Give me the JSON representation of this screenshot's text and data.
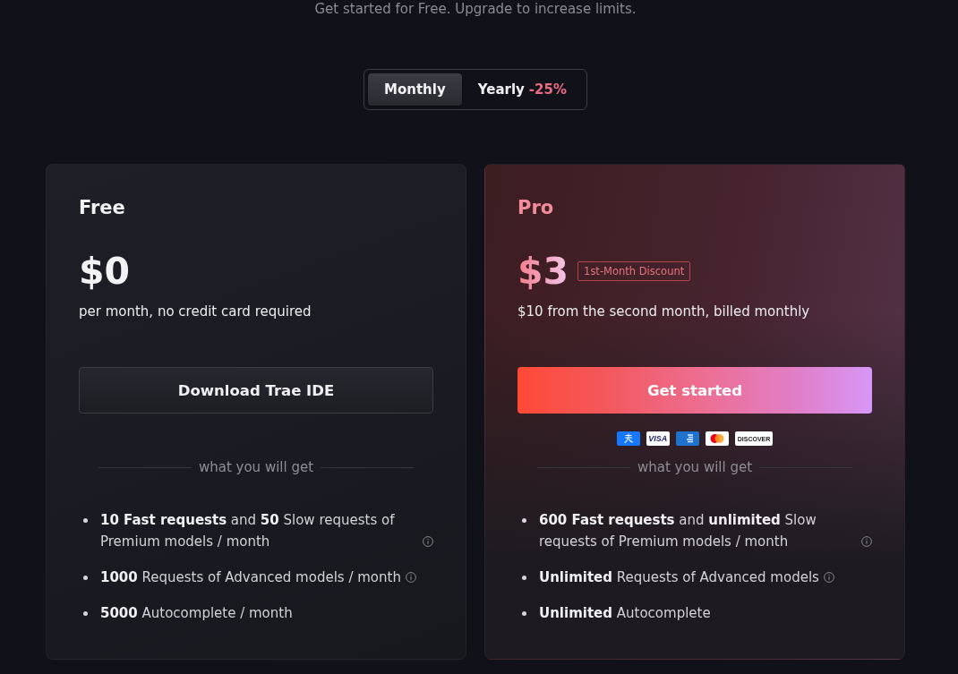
{
  "subtitle": "Get started for Free. Upgrade to increase limits.",
  "billing_toggle": {
    "tabs": [
      {
        "label": "Monthly",
        "selected": true
      },
      {
        "label": "Yearly",
        "discount": "-25%",
        "selected": false
      }
    ]
  },
  "plans": [
    {
      "kind": "free",
      "name": "Free",
      "price": "$0",
      "price_note": "per month, no credit card required",
      "button": "Download Trae IDE",
      "divider_label": "what you will get",
      "features": [
        {
          "text": "**10 Fast requests** and **50** Slow requests of Premium models / month",
          "info": true
        },
        {
          "text": "**1000** Requests of Advanced models / month",
          "info": true
        },
        {
          "text": "**5000** Autocomplete / month",
          "info": false
        }
      ]
    },
    {
      "kind": "pro",
      "name": "Pro",
      "price": "$3",
      "badge": "1st-Month Discount",
      "price_note": "$10 from the second month, billed monthly",
      "button": "Get started",
      "payment_methods": [
        {
          "kind": "alipay"
        },
        {
          "kind": "visa",
          "label": "VISA"
        },
        {
          "kind": "amex"
        },
        {
          "kind": "mastercard"
        },
        {
          "kind": "discover",
          "label": "DISCOVER"
        }
      ],
      "divider_label": "what you will get",
      "features": [
        {
          "text": "**600 Fast requests** and **unlimited** Slow requests of Premium models / month",
          "info": true
        },
        {
          "text": "**Unlimited** Requests of Advanced models",
          "info": true
        },
        {
          "text": "**Unlimited** Autocomplete",
          "info": false
        }
      ]
    }
  ]
}
